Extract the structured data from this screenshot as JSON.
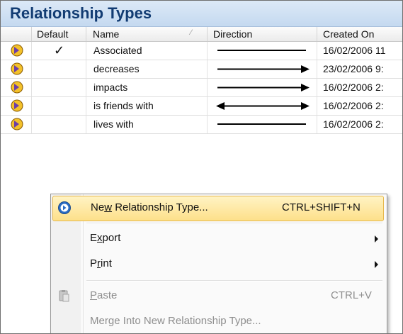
{
  "panel": {
    "title": "Relationship Types"
  },
  "grid": {
    "headers": {
      "default": "Default",
      "name": "Name",
      "direction": "Direction",
      "created_on": "Created On"
    },
    "rows": [
      {
        "default": "✓",
        "name": "Associated",
        "direction": "none",
        "created_on": "16/02/2006 11"
      },
      {
        "default": "",
        "name": "decreases",
        "direction": "forward",
        "created_on": "23/02/2006 9:"
      },
      {
        "default": "",
        "name": "impacts",
        "direction": "forward",
        "created_on": "16/02/2006 2:"
      },
      {
        "default": "",
        "name": "is friends with",
        "direction": "both",
        "created_on": "16/02/2006 2:"
      },
      {
        "default": "",
        "name": "lives with",
        "direction": "none",
        "created_on": "16/02/2006 2:"
      }
    ]
  },
  "context_menu": {
    "new": {
      "pre": "Ne",
      "key": "w",
      "post": " Relationship Type...",
      "shortcut": "CTRL+SHIFT+N"
    },
    "export": {
      "pre": "E",
      "key": "x",
      "post": "port"
    },
    "print": {
      "pre": "P",
      "key": "r",
      "post": "int"
    },
    "paste": {
      "pre": "",
      "key": "P",
      "post": "aste",
      "shortcut": "CTRL+V"
    },
    "merge": {
      "pre": "Mer",
      "key": "g",
      "post": "e Into New Relationship Type..."
    }
  }
}
